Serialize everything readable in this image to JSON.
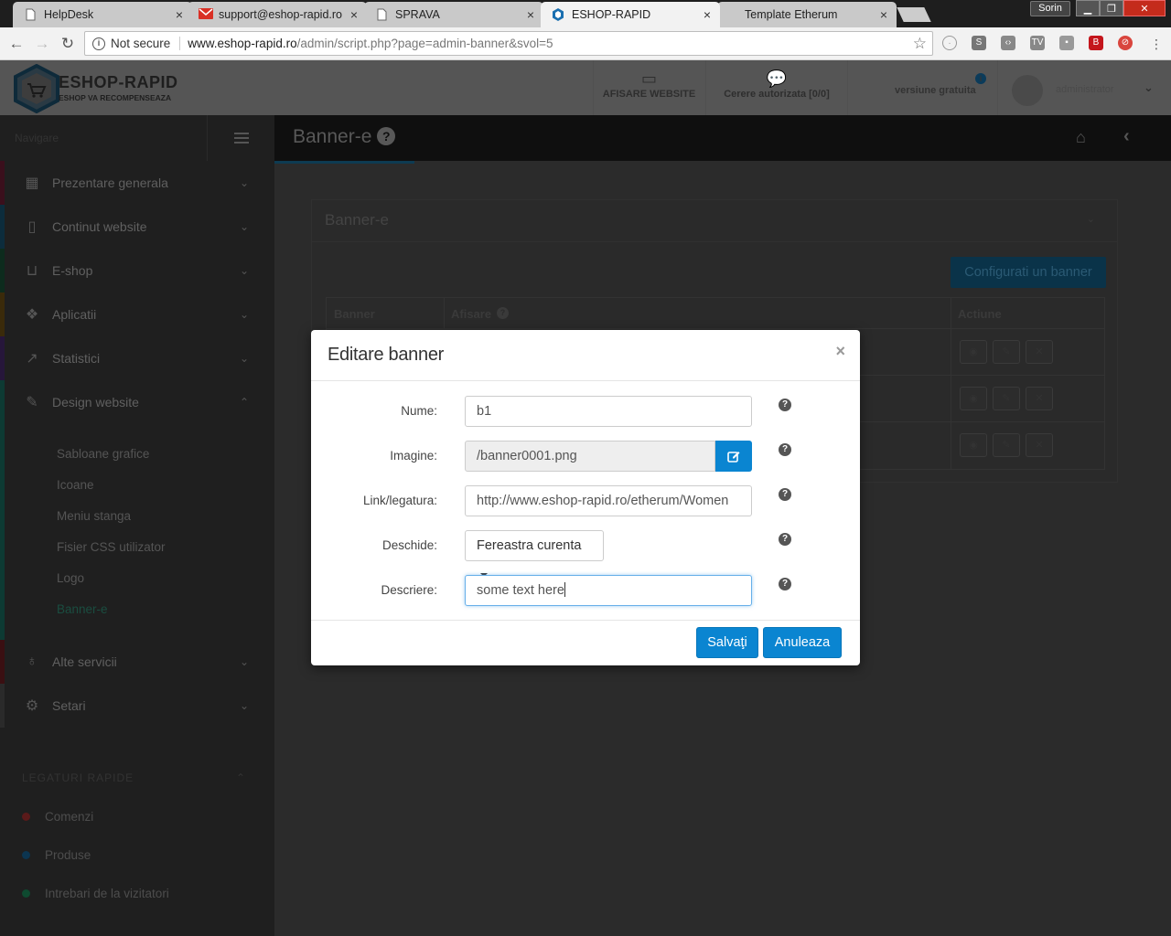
{
  "browser": {
    "tabs": [
      {
        "title": "HelpDesk",
        "close": "×"
      },
      {
        "title": "support@eshop-rapid.ro",
        "close": "×"
      },
      {
        "title": "SPRAVA",
        "close": "×"
      },
      {
        "title": "ESHOP-RAPID",
        "close": "×"
      },
      {
        "title": "Template Etherum",
        "close": "×"
      }
    ],
    "profile": "Sorin",
    "not_secure": "Not secure",
    "url_host": "www.eshop-rapid.ro",
    "url_path": "/admin/script.php?page=admin-banner&svol=5"
  },
  "header": {
    "logo_title": "ESHOP-RAPID",
    "logo_sub": "ESHOP VA RECOMPENSEAZA",
    "nav_site": "AFISARE WEBSITE",
    "nav_request": "Cerere autorizata [0/0]",
    "version": "versiune gratuita",
    "user": "administrator"
  },
  "sidebar": {
    "nav_label": "Navigare",
    "items": [
      {
        "label": "Prezentare generala",
        "color": "#3a0f1c"
      },
      {
        "label": "Continut website",
        "color": "#0c2c3c"
      },
      {
        "label": "E-shop",
        "color": "#0d2b1d"
      },
      {
        "label": "Aplicatii",
        "color": "#3a2a0a"
      },
      {
        "label": "Statistici",
        "color": "#26163a"
      },
      {
        "label": "Design website",
        "color": "#0d3a33"
      }
    ],
    "sub_items": [
      "Sabloane grafice",
      "Icoane",
      "Meniu stanga",
      "Fisier CSS utilizator",
      "Logo",
      "Banner-e"
    ],
    "more_items": [
      {
        "label": "Alte servicii",
        "color": "#3a0f12"
      },
      {
        "label": "Setari",
        "color": "#2a2a2a"
      }
    ],
    "quick_title": "LEGATURI RAPIDE",
    "quick_links": [
      {
        "label": "Comenzi",
        "color": "#5a1a1a"
      },
      {
        "label": "Produse",
        "color": "#0c3550"
      },
      {
        "label": "Intrebari de la vizitatori",
        "color": "#0e4a30"
      }
    ]
  },
  "page": {
    "title": "Banner-e",
    "panel_title": "Banner-e",
    "config_button": "Configurati un banner",
    "columns": [
      "Banner",
      "Afisare",
      "Actiune"
    ]
  },
  "modal": {
    "title": "Editare banner",
    "close": "×",
    "fields": {
      "name_label": "Nume:",
      "name_value": "b1",
      "image_label": "Imagine:",
      "image_value": "/banner0001.png",
      "link_label": "Link/legatura:",
      "link_value": "http://www.eshop-rapid.ro/etherum/Women",
      "open_label": "Deschide:",
      "open_value": "Fereastra curenta",
      "desc_label": "Descriere:",
      "desc_value": "some text here"
    },
    "save_button": "Salvaţi",
    "cancel_button": "Anuleaza"
  }
}
